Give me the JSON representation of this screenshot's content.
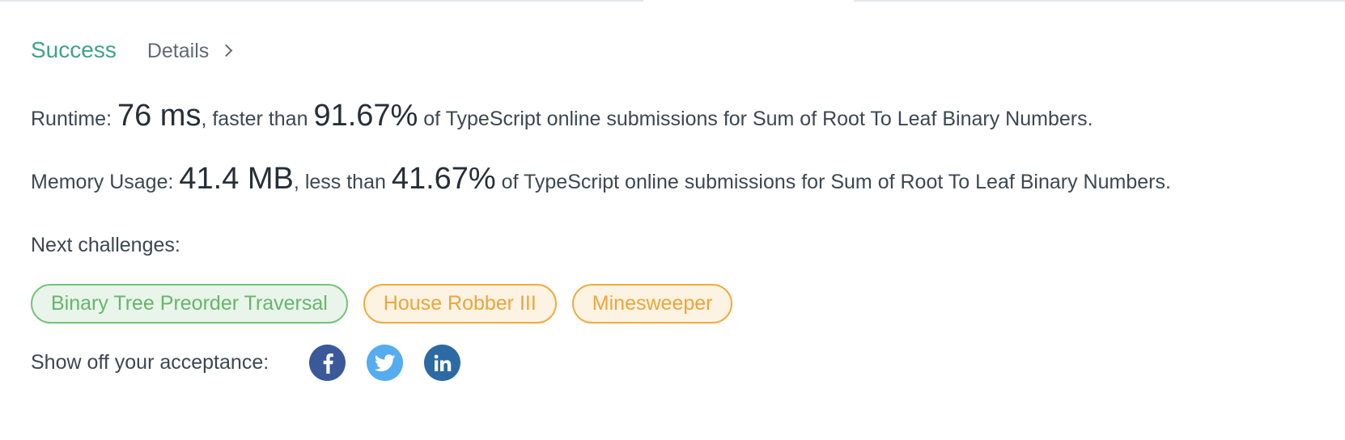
{
  "header": {
    "status": "Success",
    "details_label": "Details"
  },
  "runtime": {
    "label": "Runtime: ",
    "value": "76 ms",
    "comparison": ", faster than ",
    "percentile": "91.67%",
    "suffix": " of TypeScript online submissions for Sum of Root To Leaf Binary Numbers."
  },
  "memory": {
    "label": "Memory Usage: ",
    "value": "41.4 MB",
    "comparison": ", less than ",
    "percentile": "41.67%",
    "suffix": " of TypeScript online submissions for Sum of Root To Leaf Binary Numbers."
  },
  "next_challenges": {
    "label": "Next challenges:",
    "items": [
      {
        "label": "Binary Tree Preorder Traversal",
        "difficulty": "easy"
      },
      {
        "label": "House Robber III",
        "difficulty": "medium"
      },
      {
        "label": "Minesweeper",
        "difficulty": "medium"
      }
    ]
  },
  "share": {
    "label": "Show off your acceptance:",
    "icons": [
      {
        "name": "facebook-icon",
        "color": "#3b5998"
      },
      {
        "name": "twitter-icon",
        "color": "#55acee"
      },
      {
        "name": "linkedin-icon",
        "color": "#2b6aa3"
      }
    ]
  },
  "colors": {
    "success": "#3fa389",
    "easy": "#66b66b",
    "medium": "#eea43b"
  }
}
